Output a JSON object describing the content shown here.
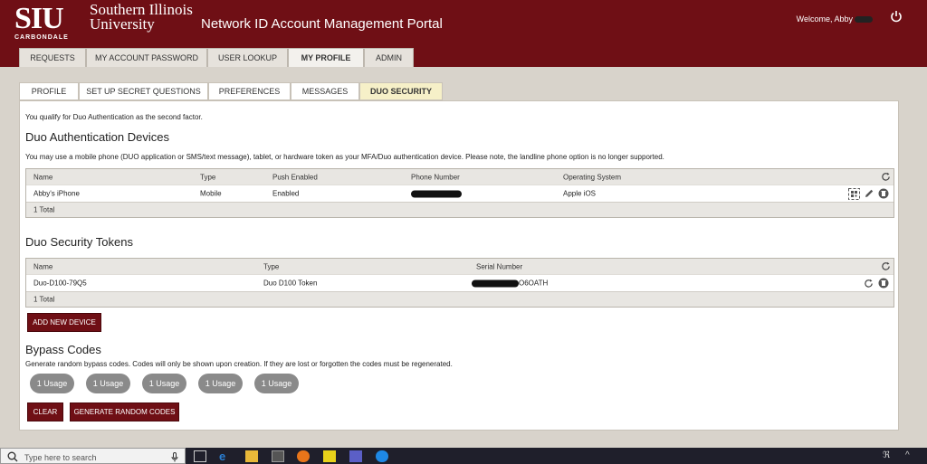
{
  "header": {
    "logo_main": "SIU",
    "logo_sub": "CARBONDALE",
    "university_line1": "Southern Illinois",
    "university_line2": "University",
    "portal_title": "Network ID Account Management Portal",
    "welcome": "Welcome, Abby"
  },
  "main_tabs": [
    {
      "label": "REQUESTS"
    },
    {
      "label": "MY ACCOUNT PASSWORD"
    },
    {
      "label": "USER LOOKUP"
    },
    {
      "label": "MY PROFILE",
      "active": true
    },
    {
      "label": "ADMIN"
    }
  ],
  "sub_tabs": [
    {
      "label": "PROFILE"
    },
    {
      "label": "SET UP SECRET QUESTIONS"
    },
    {
      "label": "PREFERENCES"
    },
    {
      "label": "MESSAGES"
    },
    {
      "label": "DUO SECURITY",
      "active": true
    }
  ],
  "content": {
    "qualify": "You qualify for Duo Authentication as the second factor.",
    "devices_title": "Duo Authentication Devices",
    "devices_desc": "You may use a mobile phone (DUO application or SMS/text message), tablet, or hardware token as your MFA/Duo authentication device. Please note, the landline phone option is no longer supported.",
    "devices_table": {
      "headers": [
        "Name",
        "Type",
        "Push Enabled",
        "Phone Number",
        "Operating System"
      ],
      "rows": [
        {
          "name": "Abby's iPhone",
          "type": "Mobile",
          "push": "Enabled",
          "phone": "",
          "os": "Apple iOS"
        }
      ],
      "total": "1 Total"
    },
    "tokens_title": "Duo Security Tokens",
    "tokens_table": {
      "headers": [
        "Name",
        "Type",
        "Serial Number"
      ],
      "rows": [
        {
          "name": "Duo-D100-79Q5",
          "type": "Duo D100 Token",
          "serial_suffix": "O6OATH"
        }
      ],
      "total": "1 Total"
    },
    "add_device": "ADD NEW DEVICE",
    "bypass_title": "Bypass Codes",
    "bypass_desc": "Generate random bypass codes. Codes will only be shown upon creation. If they are lost or forgotten the codes must be regenerated.",
    "bypass_options": [
      "1 Usage",
      "1 Usage",
      "1 Usage",
      "1 Usage",
      "1 Usage"
    ],
    "clear": "CLEAR",
    "generate": "GENERATE RANDOM CODES"
  },
  "taskbar": {
    "search_placeholder": "Type here to search"
  },
  "colors": {
    "brand": "#6f0f15",
    "active_subtab": "#f6f0c8",
    "pill": "#8a8a8a"
  },
  "icons": [
    "power-icon",
    "refresh-icon",
    "qr-code-icon",
    "pencil-icon",
    "trash-icon",
    "search-icon"
  ]
}
